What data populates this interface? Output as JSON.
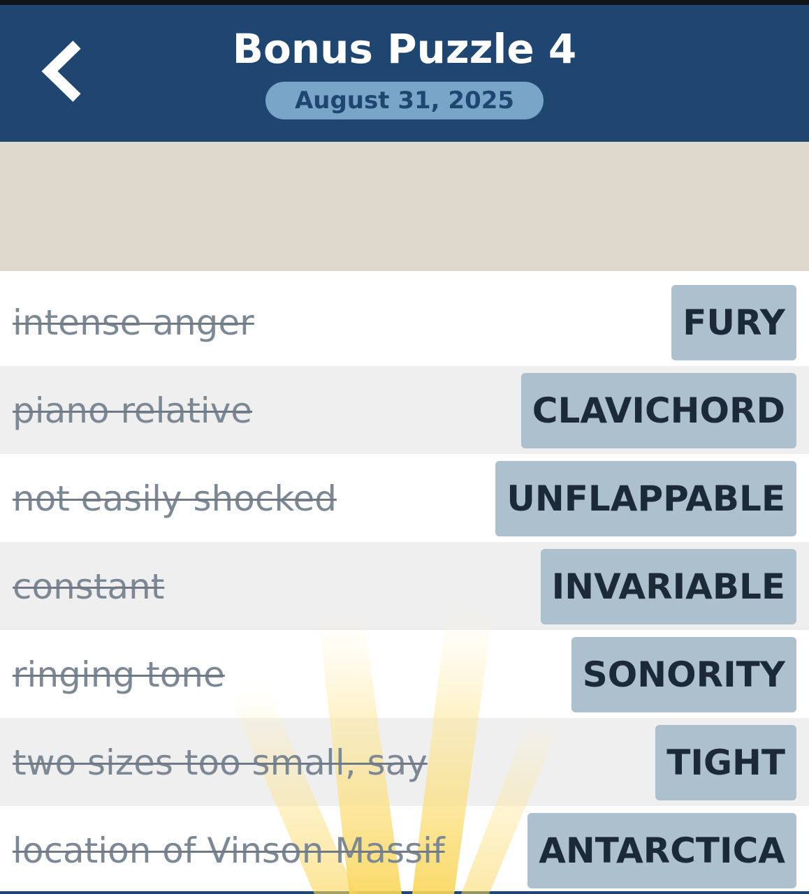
{
  "header": {
    "title": "Bonus Puzzle 4",
    "date": "August 31, 2025",
    "back_icon": "chevron-left-icon"
  },
  "clues": [
    {
      "clue": "intense anger",
      "answer": "FURY"
    },
    {
      "clue": "piano relative",
      "answer": "CLAVICHORD"
    },
    {
      "clue": "not easily shocked",
      "answer": "UNFLAPPABLE"
    },
    {
      "clue": "constant",
      "answer": "INVARIABLE"
    },
    {
      "clue": "ringing tone",
      "answer": "SONORITY"
    },
    {
      "clue": "two sizes too small, say",
      "answer": "TIGHT"
    },
    {
      "clue": "location of Vinson Massif",
      "answer": "ANTARCTICA"
    }
  ],
  "colors": {
    "header_bg": "#1f4670",
    "pill_bg": "#79a5c8",
    "banner_bg": "#dfd8cc",
    "answer_bg": "#adc0ce",
    "alt_row_bg": "#efefef"
  }
}
